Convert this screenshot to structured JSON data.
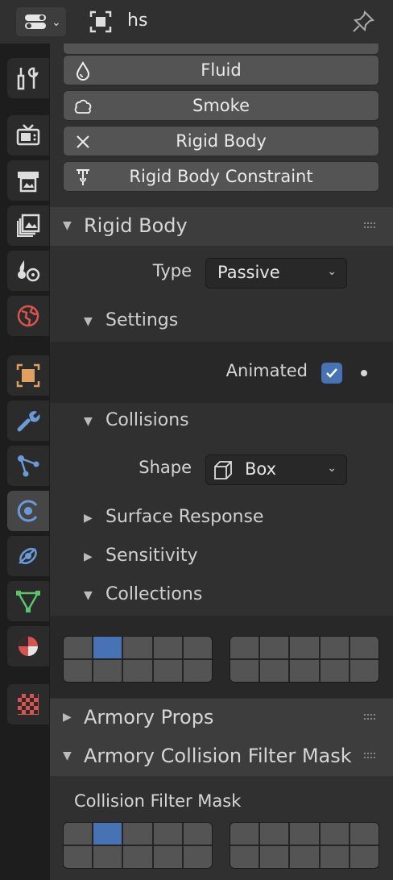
{
  "header": {
    "object_name": "hs"
  },
  "sidebar": {
    "tabs": [
      {
        "name": "tool-tab",
        "icon": "tool-icon"
      },
      {
        "name": "render-tab",
        "icon": "render-icon"
      },
      {
        "name": "output-tab",
        "icon": "output-icon"
      },
      {
        "name": "view-layer-tab",
        "icon": "view-layer-icon"
      },
      {
        "name": "scene-tab",
        "icon": "scene-icon"
      },
      {
        "name": "world-tab",
        "icon": "world-icon"
      },
      {
        "name": "object-tab",
        "icon": "object-icon"
      },
      {
        "name": "modifier-tab",
        "icon": "wrench-icon"
      },
      {
        "name": "particles-tab",
        "icon": "particles-icon"
      },
      {
        "name": "physics-tab",
        "icon": "physics-icon",
        "active": true
      },
      {
        "name": "constraints-tab",
        "icon": "constraint-icon"
      },
      {
        "name": "data-tab",
        "icon": "mesh-data-icon"
      },
      {
        "name": "material-tab",
        "icon": "material-icon"
      },
      {
        "name": "texture-tab",
        "icon": "texture-icon"
      }
    ]
  },
  "physics_buttons": {
    "fluid": "Fluid",
    "smoke": "Smoke",
    "rigid_body": "Rigid Body",
    "rigid_body_constraint": "Rigid Body Constraint"
  },
  "rigid_body": {
    "title": "Rigid Body",
    "type_label": "Type",
    "type_value": "Passive",
    "settings": {
      "title": "Settings",
      "animated_label": "Animated",
      "animated_checked": true
    },
    "collisions": {
      "title": "Collisions",
      "shape_label": "Shape",
      "shape_value": "Box",
      "surface_response": "Surface Response",
      "sensitivity": "Sensitivity",
      "collections": "Collections",
      "collections_layers": [
        [
          false,
          true,
          false,
          false,
          false,
          false,
          false,
          false,
          false,
          false
        ],
        [
          false,
          false,
          false,
          false,
          false,
          false,
          false,
          false,
          false,
          false
        ]
      ]
    }
  },
  "armory_props": {
    "title": "Armory Props"
  },
  "armory_collision": {
    "title": "Armory Collision Filter Mask",
    "label": "Collision Filter Mask",
    "layers": [
      [
        false,
        true,
        false,
        false,
        false,
        false,
        false,
        false,
        false,
        false
      ],
      [
        false,
        false,
        false,
        false,
        false,
        false,
        false,
        false,
        false,
        false
      ]
    ]
  },
  "colors": {
    "accent": "#4772b3",
    "panel_header": "#3d3d3d",
    "background": "#303030"
  }
}
